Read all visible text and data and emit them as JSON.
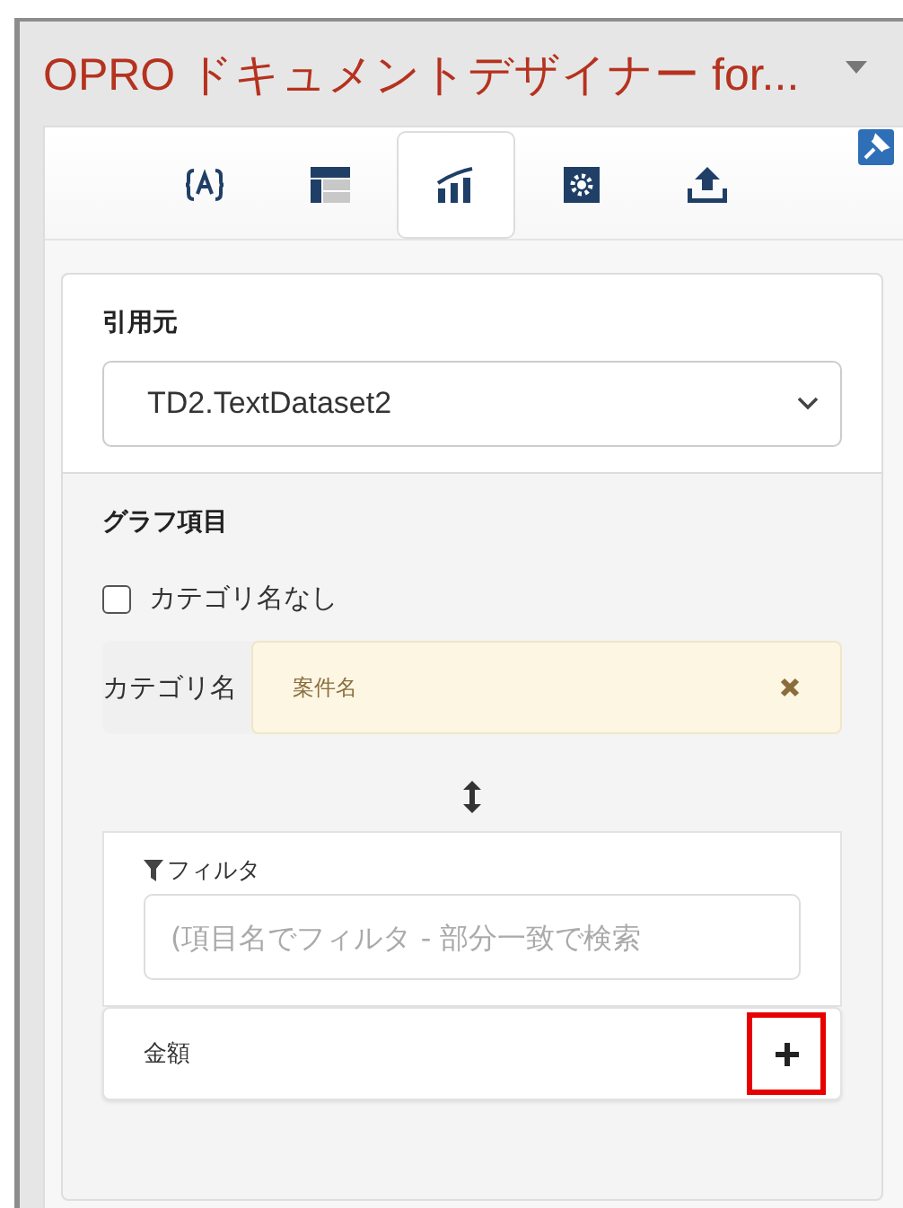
{
  "window": {
    "title": "OPRO ドキュメントデザイナー for..."
  },
  "tabs": [
    {
      "kind": "variable",
      "selected": false
    },
    {
      "kind": "table",
      "selected": false
    },
    {
      "kind": "chart",
      "selected": true
    },
    {
      "kind": "settings",
      "selected": false
    },
    {
      "kind": "upload",
      "selected": false
    }
  ],
  "source": {
    "label": "引用元",
    "value": "TD2.TextDataset2"
  },
  "graph_items": {
    "heading": "グラフ項目",
    "no_category": {
      "label": "カテゴリ名なし",
      "checked": false
    },
    "category": {
      "label": "カテゴリ名",
      "value": "案件名"
    },
    "filter": {
      "label": "フィルタ",
      "placeholder": "(項目名でフィルタ - 部分一致で検索"
    },
    "fields": [
      {
        "name": "金額",
        "highlighted": true
      }
    ]
  }
}
